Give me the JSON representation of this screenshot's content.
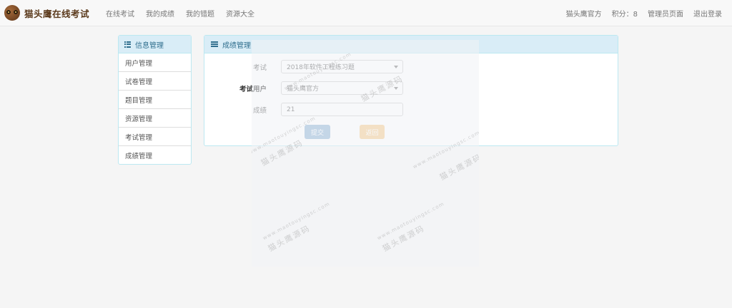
{
  "brand": {
    "name": "猫头鹰在线考试",
    "logo": "owl-logo"
  },
  "nav": {
    "left": [
      "在线考试",
      "我的成绩",
      "我的错题",
      "资源大全"
    ],
    "user": "猫头鹰官方",
    "points": "积分：8",
    "admin": "管理员页面",
    "logout": "退出登录"
  },
  "sidebar": {
    "title": "信息管理",
    "title_icon": "grid-list-icon",
    "items": [
      {
        "label": "用户管理"
      },
      {
        "label": "试卷管理"
      },
      {
        "label": "题目管理"
      },
      {
        "label": "资源管理"
      },
      {
        "label": "考试管理"
      },
      {
        "label": "成绩管理"
      }
    ]
  },
  "panel": {
    "title": "成绩管理",
    "title_icon": "list-icon",
    "form": {
      "exam_label": "考试",
      "exam_value": "2018年软件工程练习题",
      "user_label": "考试用户",
      "user_value": "猫头鹰官方",
      "score_label": "成绩",
      "score_value": "21",
      "submit_label": "提交",
      "back_label": "返回"
    }
  },
  "watermark": {
    "text": "猫头鹰源码",
    "url": "www.maotouyingsc.com"
  },
  "colors": {
    "panel_head_bg": "#d9edf7",
    "panel_border": "#bce8f1",
    "panel_text": "#31708f",
    "primary_btn": "#8fb3d6",
    "warning_btn": "#f5c98a"
  }
}
